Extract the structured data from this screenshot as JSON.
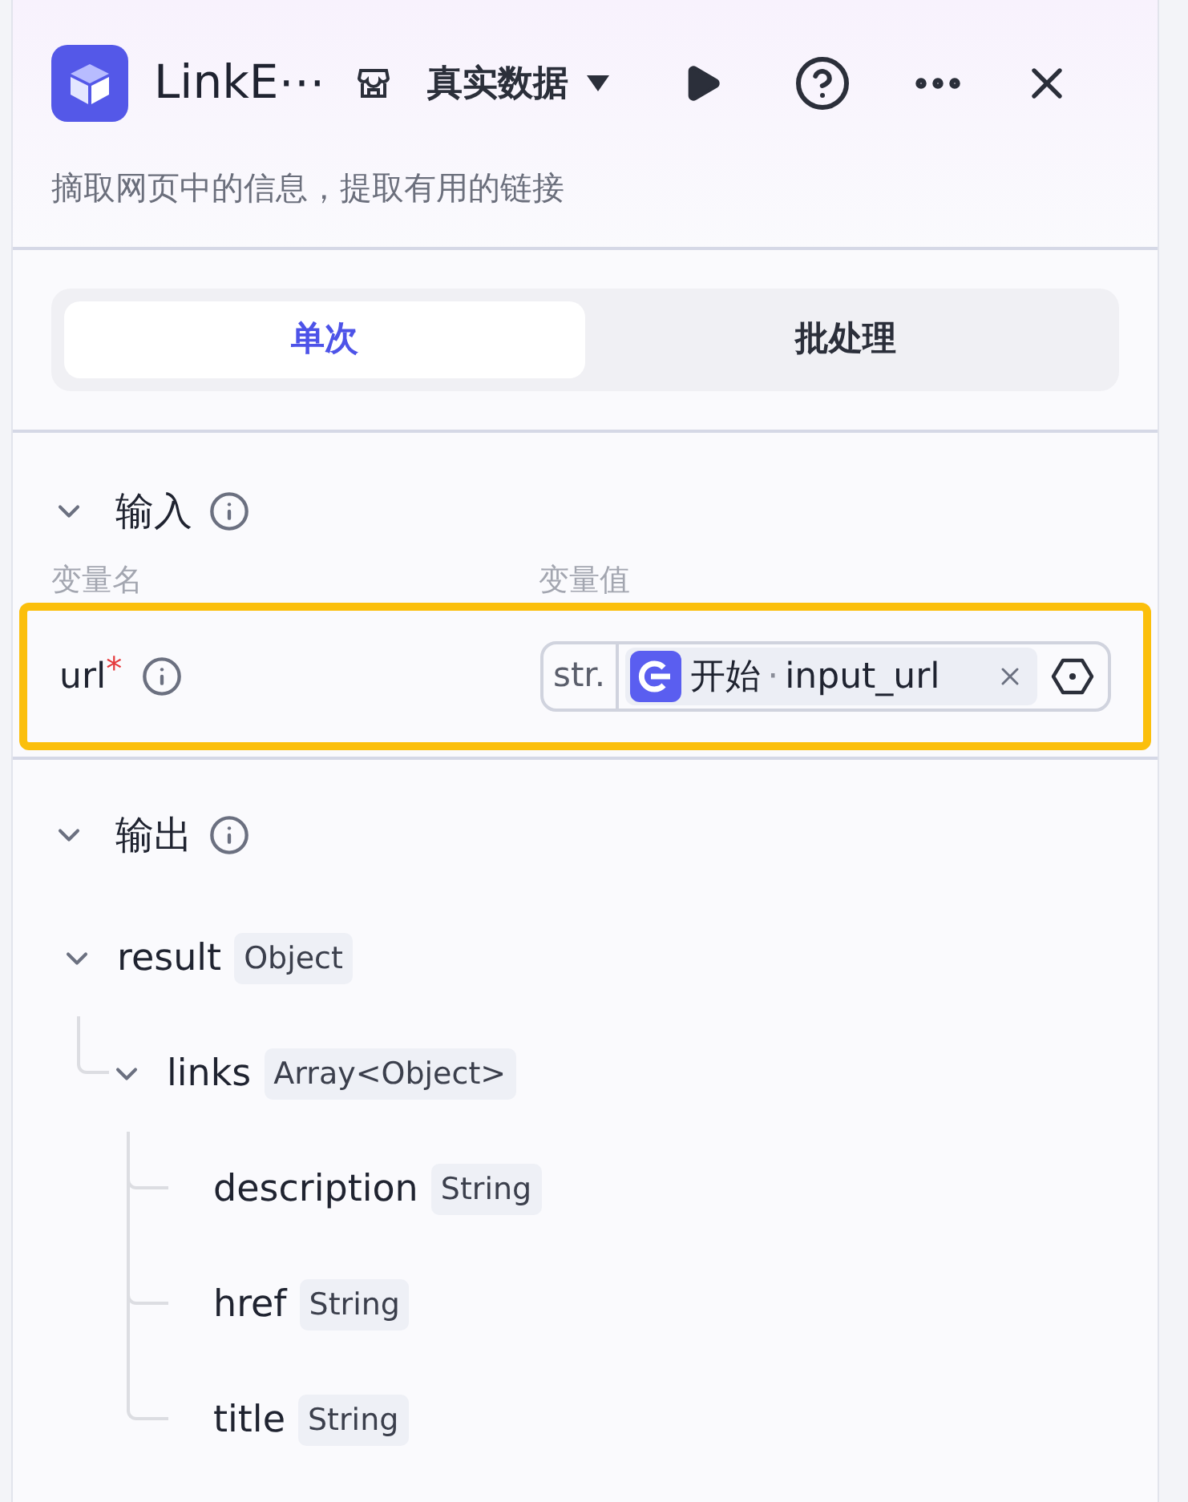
{
  "header": {
    "title": "LinkE⋯",
    "data_mode": "真实数据",
    "description": "摘取网页中的信息，提取有用的链接"
  },
  "tabs": [
    {
      "label": "单次",
      "selected": true
    },
    {
      "label": "批处理",
      "selected": false
    }
  ],
  "input": {
    "title": "输入",
    "expanded": true,
    "columns": [
      "变量名",
      "变量值"
    ],
    "highlighted": true,
    "params": [
      {
        "name": "url",
        "required_mark": "*",
        "type": "str.",
        "source": "开始",
        "separator": "·",
        "value": "input_url"
      }
    ]
  },
  "output": {
    "title": "输出",
    "expanded": true,
    "tree": [
      {
        "name": "result",
        "type": "Object",
        "expanded": true,
        "children": [
          {
            "name": "links",
            "type": "Array<Object>",
            "expanded": true,
            "children": [
              {
                "name": "description",
                "type": "String"
              },
              {
                "name": "href",
                "type": "String"
              },
              {
                "name": "title",
                "type": "String"
              }
            ]
          }
        ]
      }
    ]
  }
}
